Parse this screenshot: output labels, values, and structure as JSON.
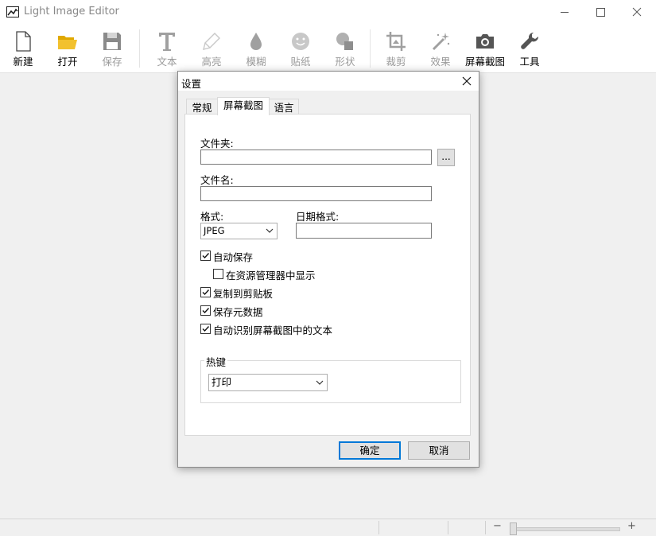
{
  "window": {
    "title": "Light Image Editor",
    "controls": {
      "minimize": "minimize-icon",
      "maximize": "maximize-icon",
      "close": "close-icon"
    }
  },
  "toolbar": {
    "new": "新建",
    "open": "打开",
    "save": "保存",
    "text": "文本",
    "highlight": "高亮",
    "blur": "模糊",
    "sticker": "贴纸",
    "shape": "形状",
    "crop": "裁剪",
    "effects": "效果",
    "screenshot": "屏幕截图",
    "tools": "工具"
  },
  "colors": {
    "accent": "#0078d7",
    "folder": "#f2c12e",
    "canvas": "#f0f0f0"
  },
  "status": {
    "zoom_minus": "−",
    "zoom_plus": "+",
    "zoom_level": 0.02
  },
  "dialog": {
    "title": "设置",
    "tabs": [
      "常规",
      "屏幕截图",
      "语言"
    ],
    "active_tab": "屏幕截图",
    "folder_label": "文件夹:",
    "folder_value": "",
    "browse_label": "...",
    "filename_label": "文件名:",
    "filename_value": "",
    "format_label": "格式:",
    "format_value": "JPEG",
    "date_format_label": "日期格式:",
    "date_format_value": "",
    "auto_save": {
      "label": "自动保存",
      "checked": true
    },
    "show_in_explorer": {
      "label": "在资源管理器中显示",
      "checked": false
    },
    "copy_clipboard": {
      "label": "复制到剪贴板",
      "checked": true
    },
    "save_metadata": {
      "label": "保存元数据",
      "checked": true
    },
    "auto_ocr": {
      "label": "自动识别屏幕截图中的文本",
      "checked": true
    },
    "hotkey_group": "热键",
    "hotkey_value": "打印",
    "ok": "确定",
    "cancel": "取消"
  }
}
